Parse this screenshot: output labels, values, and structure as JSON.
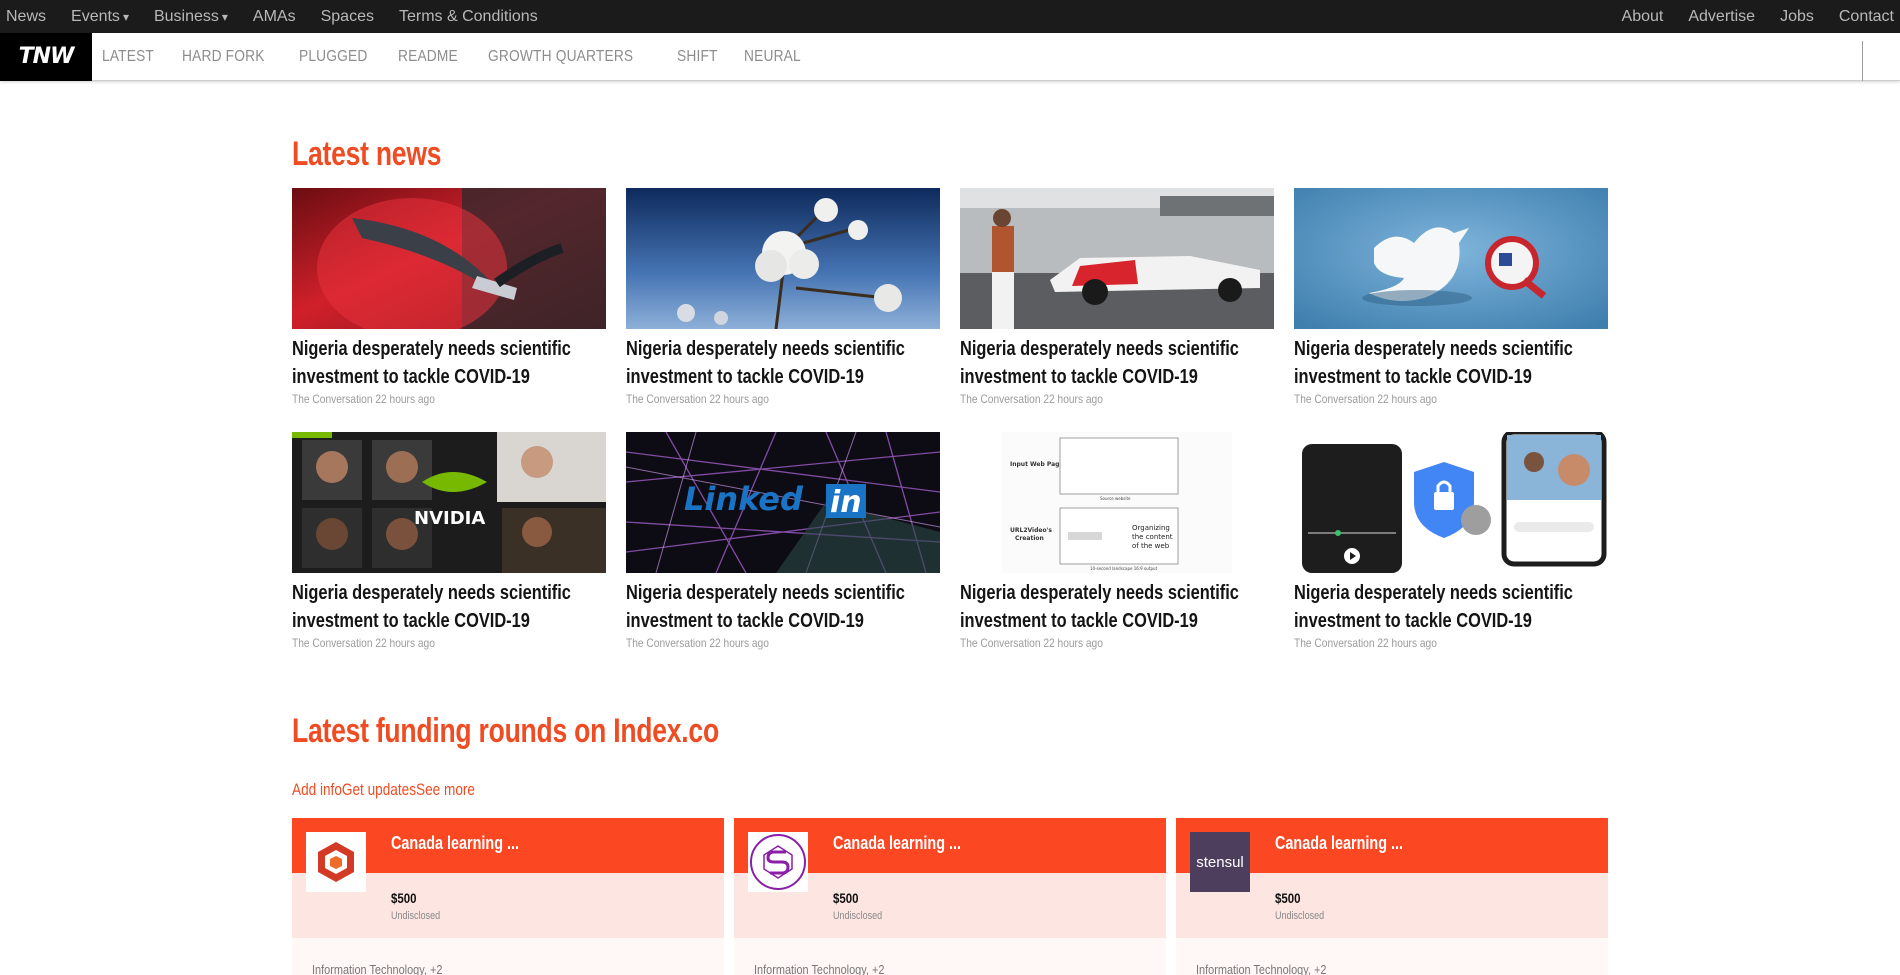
{
  "topbar": {
    "left": [
      {
        "label": "News",
        "has_caret": false
      },
      {
        "label": "Events",
        "has_caret": true
      },
      {
        "label": "Business",
        "has_caret": true
      },
      {
        "label": "AMAs",
        "has_caret": false
      },
      {
        "label": "Spaces",
        "has_caret": false
      },
      {
        "label": "Terms & Conditions",
        "has_caret": false
      }
    ],
    "right": [
      "About",
      "Advertise",
      "Jobs",
      "Contact"
    ],
    "caret_glyph": "▾"
  },
  "navbar": {
    "logo": "TNW",
    "sections": [
      "LATEST",
      "HARD FORK",
      "PLUGGED",
      "README",
      "GROWTH QUARTERS",
      "SHIFT",
      "NEURAL"
    ]
  },
  "latest": {
    "title": "Latest news",
    "articles": [
      {
        "title": "Nigeria desperately needs scientific investment to tackle COVID-19",
        "meta": "The Conversation 22 hours ago",
        "image": "ev-charger"
      },
      {
        "title": "Nigeria desperately needs scientific investment to tackle COVID-19",
        "meta": "The Conversation 22 hours ago",
        "image": "cotton-plant"
      },
      {
        "title": "Nigeria desperately needs scientific investment to tackle COVID-19",
        "meta": "The Conversation 22 hours ago",
        "image": "race-car"
      },
      {
        "title": "Nigeria desperately needs scientific investment to tackle COVID-19",
        "meta": "The Conversation 22 hours ago",
        "image": "twitter-q"
      },
      {
        "title": "Nigeria desperately needs scientific investment to tackle COVID-19",
        "meta": "The Conversation 22 hours ago",
        "image": "nvidia-faces"
      },
      {
        "title": "Nigeria desperately needs scientific investment to tackle COVID-19",
        "meta": "The Conversation 22 hours ago",
        "image": "linkedin-mesh"
      },
      {
        "title": "Nigeria desperately needs scientific investment to tackle COVID-19",
        "meta": "The Conversation 22 hours ago",
        "image": "url2video-diagram"
      },
      {
        "title": "Nigeria desperately needs scientific investment to tackle COVID-19",
        "meta": "The Conversation 22 hours ago",
        "image": "google-privacy"
      }
    ]
  },
  "funding": {
    "title": "Latest funding rounds on Index.co",
    "links": [
      "Add info",
      "Get updates",
      "See more"
    ],
    "cards": [
      {
        "name": "Canada learning ...",
        "amount": "$500",
        "stage": "Undisclosed",
        "category": "Information Technology, +2",
        "logo": "hex-cube"
      },
      {
        "name": "Canada learning ...",
        "amount": "$500",
        "stage": "Undisclosed",
        "category": "Information Technology, +2",
        "logo": "s-circle"
      },
      {
        "name": "Canada learning ...",
        "amount": "$500",
        "stage": "Undisclosed",
        "category": "Information Technology, +2",
        "logo": "stensul",
        "logo_text": "stensul"
      }
    ]
  },
  "colors": {
    "accent": "#f04c24",
    "funding_header": "#fc4723",
    "topbar_bg": "#1b1b1b"
  }
}
